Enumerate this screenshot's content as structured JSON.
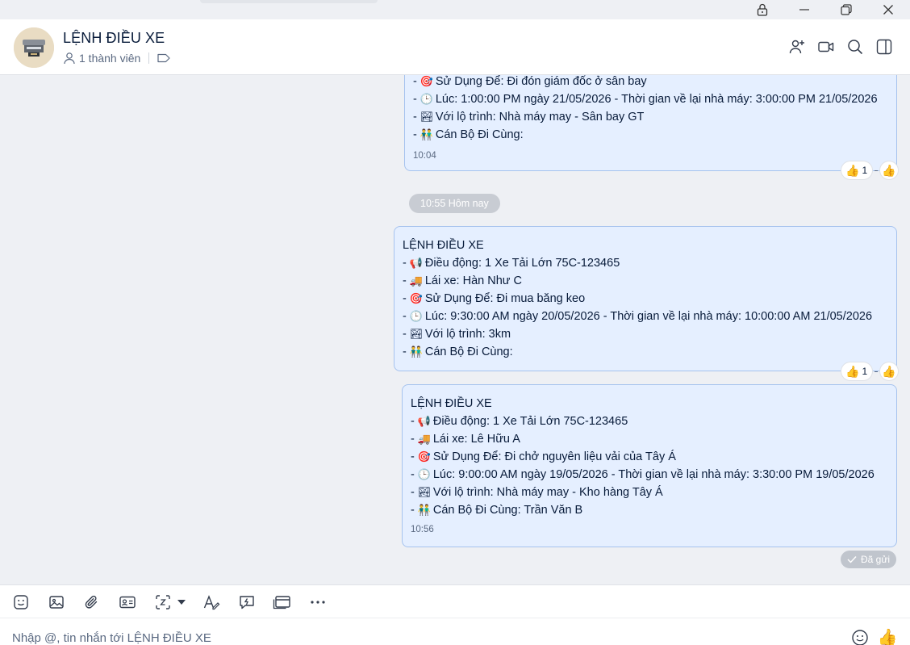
{
  "window": {
    "controls": [
      "lock-icon",
      "minimize-icon",
      "restore-icon",
      "close-icon"
    ]
  },
  "header": {
    "title": "LỆNH ĐIỀU XE",
    "members": "1 thành viên",
    "icons": [
      "add-member-icon",
      "video-call-icon",
      "search-icon",
      "sidebar-toggle-icon"
    ]
  },
  "messages": [
    {
      "partial": true,
      "lines": [
        {
          "prefix": "- ",
          "icon": "🎯",
          "text": "Sử Dụng Để: Đi đón giám đốc ở sân bay"
        },
        {
          "prefix": "- ",
          "icon": "🕒",
          "text": "Lúc: 1:00:00 PM ngày 21/05/2026 - Thời gian về lại nhà máy: 3:00:00 PM 21/05/2026"
        },
        {
          "prefix": "- ",
          "icon": "🏞",
          "text": "Với lộ trình: Nhà máy may - Sân bay GT"
        },
        {
          "prefix": "- ",
          "icon": "👬",
          "text": "Cán Bộ Đi Cùng:"
        }
      ],
      "time": "10:04",
      "reaction": {
        "emoji": "👍",
        "count": "1"
      }
    },
    {
      "title": "LỆNH ĐIỀU XE",
      "lines": [
        {
          "prefix": "- ",
          "icon": "📢",
          "text": "Điều động:  1 Xe Tải Lớn 75C-123465"
        },
        {
          "prefix": "- ",
          "icon": "🚚",
          "text": "Lái xe: Hàn Như C"
        },
        {
          "prefix": "- ",
          "icon": "🎯",
          "text": "Sử Dụng Để: Đi mua băng keo"
        },
        {
          "prefix": "- ",
          "icon": "🕒",
          "text": "Lúc: 9:30:00 AM ngày 20/05/2026 - Thời gian về lại nhà máy: 10:00:00 AM 21/05/2026"
        },
        {
          "prefix": "- ",
          "icon": "🏞",
          "text": "Với lộ trình: 3km"
        },
        {
          "prefix": "- ",
          "icon": "👬",
          "text": "Cán Bộ Đi Cùng:"
        }
      ],
      "reaction": {
        "emoji": "👍",
        "count": "1"
      }
    },
    {
      "title": "LỆNH ĐIỀU XE",
      "lines": [
        {
          "prefix": "- ",
          "icon": "📢",
          "text": "Điều động:  1 Xe Tải Lớn 75C-123465"
        },
        {
          "prefix": "- ",
          "icon": "🚚",
          "text": "Lái xe: Lê Hữu A"
        },
        {
          "prefix": "- ",
          "icon": "🎯",
          "text": "Sử Dụng Để: Đi chở nguyên liệu vải của Tây Á"
        },
        {
          "prefix": "- ",
          "icon": "🕒",
          "text": "Lúc: 9:00:00 AM ngày 19/05/2026 - Thời gian về lại nhà máy: 3:30:00 PM 19/05/2026"
        },
        {
          "prefix": "- ",
          "icon": "🏞",
          "text": "Với lộ trình: Nhà máy may - Kho hàng Tây Á"
        },
        {
          "prefix": "- ",
          "icon": "👬",
          "text": "Cán Bộ Đi Cùng: Trần Văn B"
        }
      ],
      "time": "10:56"
    }
  ],
  "day_separator": "10:55 Hôm nay",
  "sent_status": "Đã gửi",
  "toolbar": {
    "icons": [
      "sticker-icon",
      "image-icon",
      "attachment-icon",
      "contact-card-icon",
      "screenshot-icon",
      "dropdown-caret-icon",
      "text-format-icon",
      "quick-message-icon",
      "payment-card-icon",
      "more-icon"
    ]
  },
  "composer": {
    "placeholder": "Nhập @, tin nhắn tới LỆNH ĐIỀU XE",
    "value": "",
    "icons": [
      "emoji-icon",
      "like-icon"
    ]
  },
  "colors": {
    "bubble_bg": "#e5efff",
    "bubble_border": "#a6c3ee",
    "text": "#081b3a",
    "muted": "#5a6981",
    "pill_gray": "#c8ccd3"
  }
}
